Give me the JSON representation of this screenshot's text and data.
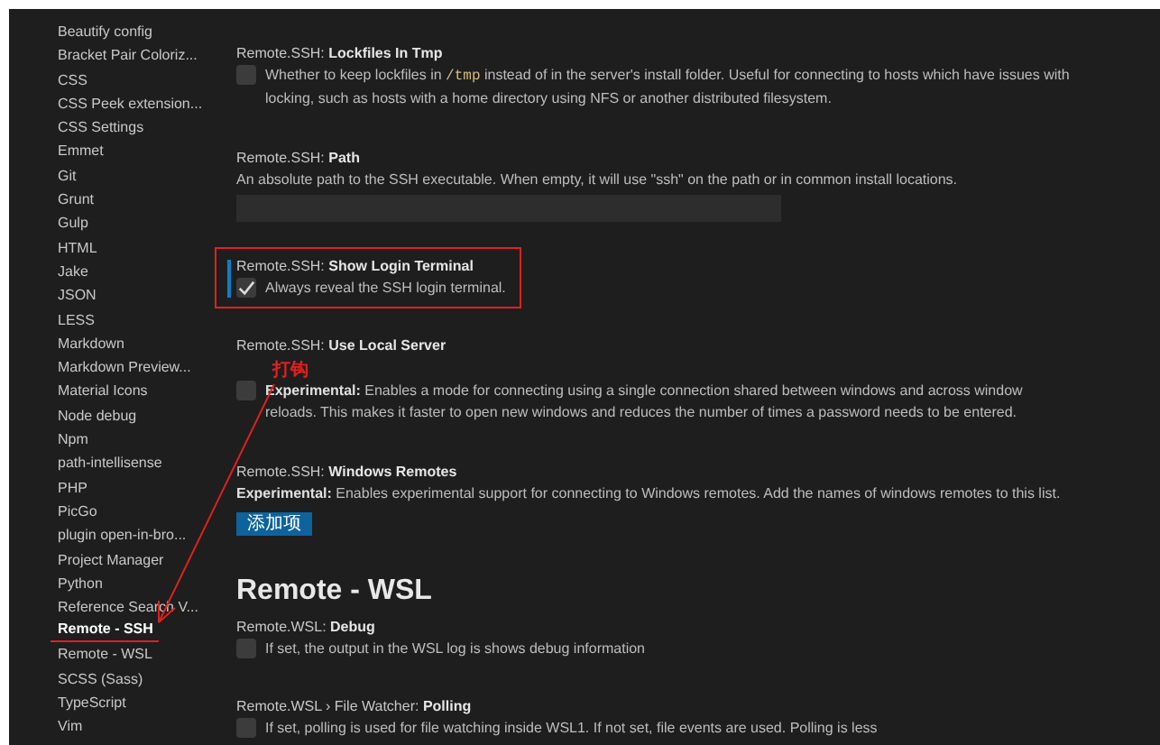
{
  "sidebar": {
    "items": [
      {
        "label": "Beautify config",
        "selected": false
      },
      {
        "label": "Bracket Pair Coloriz...",
        "selected": false
      },
      {
        "label": "CSS",
        "selected": false
      },
      {
        "label": "CSS Peek extension...",
        "selected": false
      },
      {
        "label": "CSS Settings",
        "selected": false
      },
      {
        "label": "Emmet",
        "selected": false
      },
      {
        "label": "Git",
        "selected": false
      },
      {
        "label": "Grunt",
        "selected": false
      },
      {
        "label": "Gulp",
        "selected": false
      },
      {
        "label": "HTML",
        "selected": false
      },
      {
        "label": "Jake",
        "selected": false
      },
      {
        "label": "JSON",
        "selected": false
      },
      {
        "label": "LESS",
        "selected": false
      },
      {
        "label": "Markdown",
        "selected": false
      },
      {
        "label": "Markdown Preview...",
        "selected": false
      },
      {
        "label": "Material Icons",
        "selected": false
      },
      {
        "label": "Node debug",
        "selected": false
      },
      {
        "label": "Npm",
        "selected": false
      },
      {
        "label": "path-intellisense",
        "selected": false
      },
      {
        "label": "PHP",
        "selected": false
      },
      {
        "label": "PicGo",
        "selected": false
      },
      {
        "label": "plugin open-in-bro...",
        "selected": false
      },
      {
        "label": "Project Manager",
        "selected": false
      },
      {
        "label": "Python",
        "selected": false
      },
      {
        "label": "Reference Search V...",
        "selected": false
      },
      {
        "label": "Remote - SSH",
        "selected": true,
        "underlined": true
      },
      {
        "label": "Remote - WSL",
        "selected": false
      },
      {
        "label": "SCSS (Sass)",
        "selected": false
      },
      {
        "label": "TypeScript",
        "selected": false
      },
      {
        "label": "Vim",
        "selected": false
      }
    ]
  },
  "content": [
    {
      "kind": "setting",
      "prefix": "Remote.SSH: ",
      "name": "Lockfiles In Tmp",
      "control": {
        "kind": "checkbox",
        "checked": false
      },
      "description": [
        {
          "kind": "plain",
          "text": "Whether to keep lockfiles in "
        },
        {
          "kind": "code",
          "text": "/tmp"
        },
        {
          "kind": "plain",
          "text": " instead of in the server's install folder. Useful for connecting to hosts which have issues with locking, such as hosts with a home directory using NFS or another distributed filesystem."
        }
      ]
    },
    {
      "kind": "setting",
      "prefix": "Remote.SSH: ",
      "name": "Path",
      "control": {
        "kind": "text"
      },
      "description": [
        {
          "kind": "plain",
          "text": "An absolute path to the SSH executable. When empty, it will use \"ssh\" on the path or in common install locations."
        }
      ]
    },
    {
      "kind": "setting",
      "prefix": "Remote.SSH: ",
      "name": "Show Login Terminal",
      "control": {
        "kind": "checkbox",
        "checked": true
      },
      "focused": true,
      "highlighted": true,
      "description": [
        {
          "kind": "plain",
          "text": "Always reveal the SSH login terminal."
        }
      ]
    },
    {
      "kind": "setting",
      "prefix": "Remote.SSH: ",
      "name": "Use Local Server",
      "control": {
        "kind": "checkbox",
        "checked": false
      },
      "description": [
        {
          "kind": "bold",
          "text": "Experimental:"
        },
        {
          "kind": "plain",
          "text": " Enables a mode for connecting using a single connection shared between windows and across window reloads. This makes it faster to open new windows and reduces the number of times a password needs to be entered."
        }
      ]
    },
    {
      "kind": "setting",
      "prefix": "Remote.SSH: ",
      "name": "Windows Remotes",
      "control": {
        "kind": "button",
        "label": "添加项"
      },
      "description": [
        {
          "kind": "bold",
          "text": "Experimental:"
        },
        {
          "kind": "plain",
          "text": " Enables experimental support for connecting to Windows remotes. Add the names of windows remotes to this list."
        }
      ]
    },
    {
      "kind": "heading",
      "text": "Remote - WSL"
    },
    {
      "kind": "setting",
      "prefix": "Remote.WSL: ",
      "name": "Debug",
      "control": {
        "kind": "checkbox",
        "checked": false
      },
      "description": [
        {
          "kind": "plain",
          "text": "If set, the output in the WSL log is shows debug information"
        }
      ]
    },
    {
      "kind": "setting",
      "prefix": "Remote.WSL › File Watcher: ",
      "name": "Polling",
      "control": {
        "kind": "checkbox",
        "checked": false
      },
      "description": [
        {
          "kind": "plain",
          "text": "If set, polling is used for file watching inside WSL1. If not set, file events are used. Polling is less"
        }
      ]
    }
  ],
  "annotation": {
    "label": "打钩"
  }
}
